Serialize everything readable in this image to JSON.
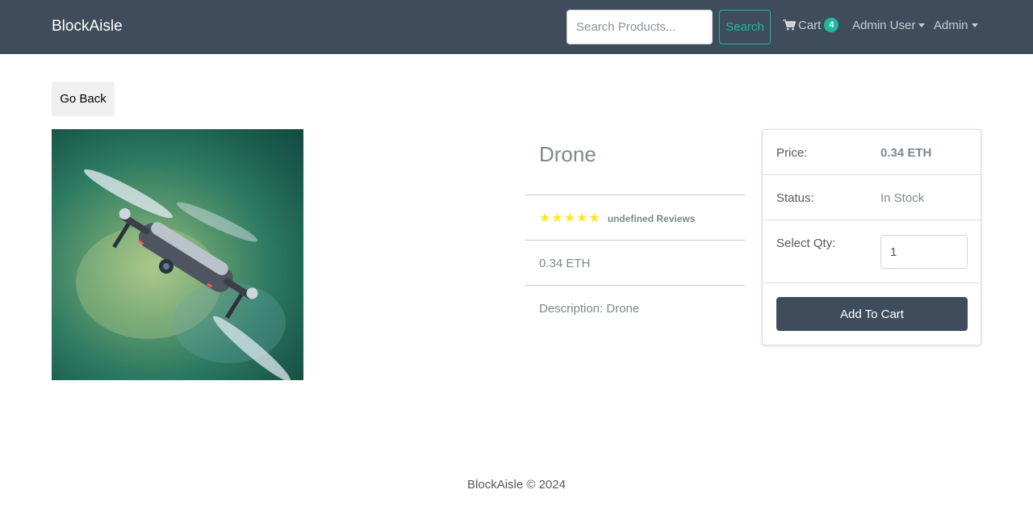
{
  "navbar": {
    "brand": "BlockAisle",
    "search_placeholder": "Search Products...",
    "search_button": "Search",
    "cart_label": "Cart",
    "cart_count": "4",
    "user_menu": "Admin User",
    "admin_menu": "Admin"
  },
  "go_back_label": "Go Back",
  "product": {
    "name": "Drone",
    "rating_stars": 5,
    "reviews_text": "undefined Reviews",
    "price_line": "0.34 ETH",
    "description_line": "Description: Drone"
  },
  "cart_card": {
    "price_label": "Price:",
    "price_value": "0.34 ETH",
    "status_label": "Status:",
    "status_value": "In Stock",
    "qty_label": "Select Qty:",
    "qty_value": "1",
    "add_button": "Add To Cart"
  },
  "footer": {
    "text": "BlockAisle © 2024"
  },
  "colors": {
    "navbar_bg": "#3e4c5b",
    "accent": "#1fb9a0",
    "star": "#f8e825"
  }
}
